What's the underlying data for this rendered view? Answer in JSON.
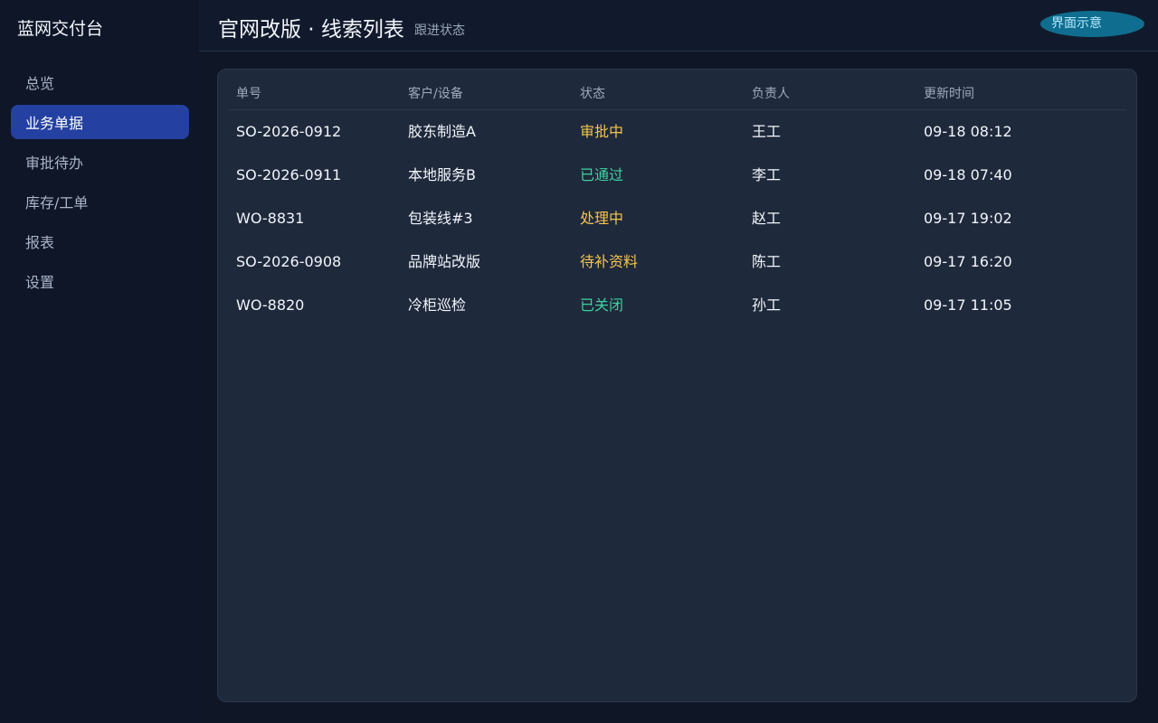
{
  "app": {
    "brand": "蓝网交付台"
  },
  "sidebar": {
    "items": [
      {
        "label": "总览",
        "active": false
      },
      {
        "label": "业务单据",
        "active": true
      },
      {
        "label": "审批待办",
        "active": false
      },
      {
        "label": "库存/工单",
        "active": false
      },
      {
        "label": "报表",
        "active": false
      },
      {
        "label": "设置",
        "active": false
      }
    ]
  },
  "header": {
    "title": "官网改版 · 线索列表",
    "subtitle": "跟进状态",
    "badge": "界面示意"
  },
  "table": {
    "columns": [
      "单号",
      "客户/设备",
      "状态",
      "负责人",
      "更新时间"
    ],
    "rows": [
      {
        "id": "SO-2026-0912",
        "customer": "胶东制造A",
        "status": "审批中",
        "owner": "王工",
        "updated": "09-18 08:12",
        "status_color": "#f4c44e"
      },
      {
        "id": "SO-2026-0911",
        "customer": "本地服务B",
        "status": "已通过",
        "owner": "李工",
        "updated": "09-18 07:40",
        "status_color": "#3fd0a0"
      },
      {
        "id": "WO-8831",
        "customer": "包装线#3",
        "status": "处理中",
        "owner": "赵工",
        "updated": "09-17 19:02",
        "status_color": "#f4c44e"
      },
      {
        "id": "SO-2026-0908",
        "customer": "品牌站改版",
        "status": "待补资料",
        "owner": "陈工",
        "updated": "09-17 16:20",
        "status_color": "#f4c44e"
      },
      {
        "id": "WO-8820",
        "customer": "冷柜巡检",
        "status": "已关闭",
        "owner": "孙工",
        "updated": "09-17 11:05",
        "status_color": "#3fd0a0"
      }
    ]
  },
  "colors": {
    "accent": "#2440a0",
    "badge": "#0f6e8f",
    "status_pending": "#f4c44e",
    "status_done": "#3fd0a0"
  }
}
